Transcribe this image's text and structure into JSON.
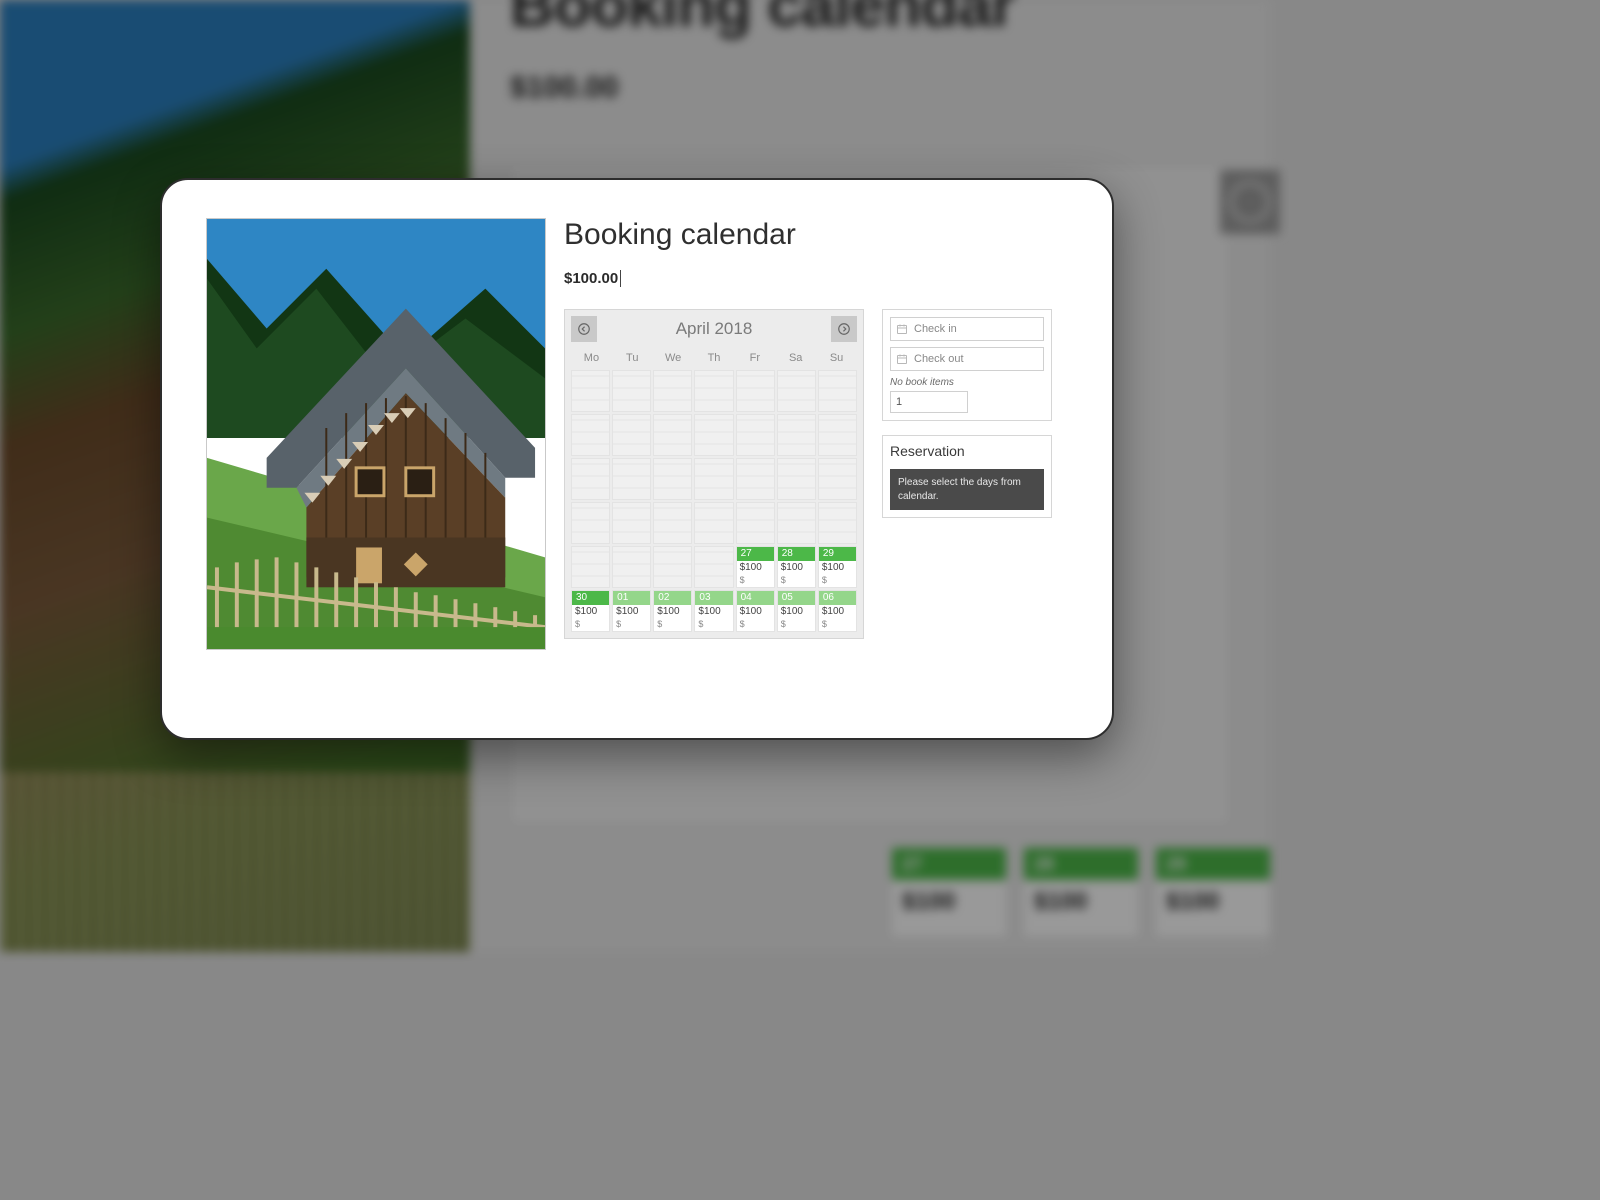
{
  "background": {
    "title": "Booking calendar",
    "price": "$100.00",
    "cells": [
      {
        "day": "27",
        "price": "$100"
      },
      {
        "day": "28",
        "price": "$100"
      },
      {
        "day": "29",
        "price": "$100"
      }
    ]
  },
  "modal": {
    "title": "Booking calendar",
    "price": "$100.00"
  },
  "calendar": {
    "month": "April 2018",
    "dow": [
      "Mo",
      "Tu",
      "We",
      "Th",
      "Fr",
      "Sa",
      "Su"
    ],
    "rows": [
      [
        {
          "t": "stripe"
        },
        {
          "t": "stripe"
        },
        {
          "t": "stripe"
        },
        {
          "t": "stripe"
        },
        {
          "t": "stripe"
        },
        {
          "t": "stripe"
        },
        {
          "t": "stripe"
        }
      ],
      [
        {
          "t": "stripe"
        },
        {
          "t": "stripe"
        },
        {
          "t": "stripe"
        },
        {
          "t": "stripe"
        },
        {
          "t": "stripe"
        },
        {
          "t": "stripe"
        },
        {
          "t": "stripe"
        }
      ],
      [
        {
          "t": "stripe"
        },
        {
          "t": "stripe"
        },
        {
          "t": "stripe"
        },
        {
          "t": "stripe"
        },
        {
          "t": "stripe"
        },
        {
          "t": "stripe"
        },
        {
          "t": "stripe"
        }
      ],
      [
        {
          "t": "stripe"
        },
        {
          "t": "stripe"
        },
        {
          "t": "stripe"
        },
        {
          "t": "stripe"
        },
        {
          "t": "stripe"
        },
        {
          "t": "stripe"
        },
        {
          "t": "stripe"
        }
      ],
      [
        {
          "t": "stripe"
        },
        {
          "t": "stripe"
        },
        {
          "t": "stripe"
        },
        {
          "t": "stripe"
        },
        {
          "t": "avail",
          "c": "green",
          "d": "27",
          "p": "$100"
        },
        {
          "t": "avail",
          "c": "green",
          "d": "28",
          "p": "$100"
        },
        {
          "t": "avail",
          "c": "green",
          "d": "29",
          "p": "$100"
        }
      ],
      [
        {
          "t": "avail",
          "c": "green",
          "d": "30",
          "p": "$100"
        },
        {
          "t": "avail",
          "c": "lightgreen",
          "d": "01",
          "p": "$100"
        },
        {
          "t": "avail",
          "c": "lightgreen",
          "d": "02",
          "p": "$100"
        },
        {
          "t": "avail",
          "c": "lightgreen",
          "d": "03",
          "p": "$100"
        },
        {
          "t": "avail",
          "c": "lightgreen",
          "d": "04",
          "p": "$100"
        },
        {
          "t": "avail",
          "c": "lightgreen",
          "d": "05",
          "p": "$100"
        },
        {
          "t": "avail",
          "c": "lightgreen",
          "d": "06",
          "p": "$100"
        }
      ]
    ]
  },
  "booking": {
    "checkin_placeholder": "Check in",
    "checkout_placeholder": "Check out",
    "nobook_label": "No book items",
    "nobook_value": "1"
  },
  "reservation": {
    "title": "Reservation",
    "message": "Please select the days from calendar."
  }
}
